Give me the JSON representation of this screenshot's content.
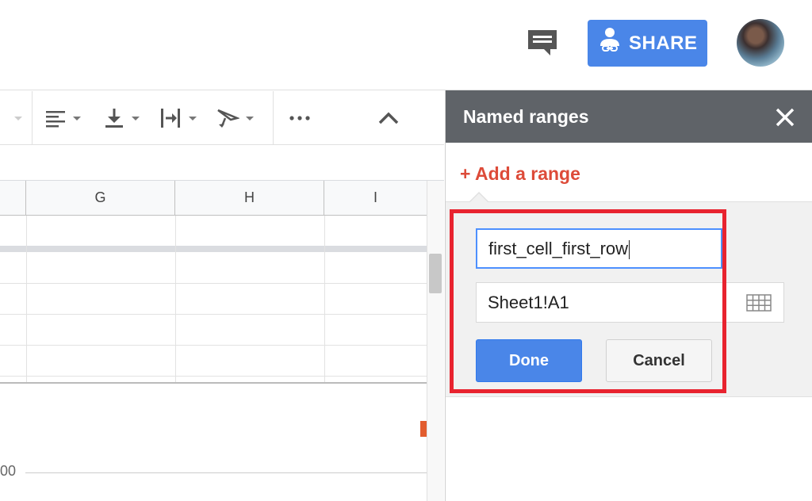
{
  "header": {
    "share_label": "SHARE",
    "icons": [
      "comment-icon",
      "person-link-icon"
    ],
    "accent_color": "#4a86e8"
  },
  "toolbar": {
    "icons": [
      "horizontal-align-icon",
      "vertical-align-icon",
      "text-wrap-icon",
      "text-rotation-icon",
      "more-icon",
      "collapse-icon"
    ]
  },
  "grid": {
    "columns": [
      "G",
      "H",
      "I"
    ],
    "chart_tick": "00"
  },
  "panel": {
    "title": "Named ranges",
    "add_range_label": "+ Add a range",
    "name_value": "first_cell_first_row",
    "range_value": "Sheet1!A1",
    "done_label": "Done",
    "cancel_label": "Cancel",
    "add_color": "#dd4b39",
    "highlight_color": "#e8232f"
  }
}
